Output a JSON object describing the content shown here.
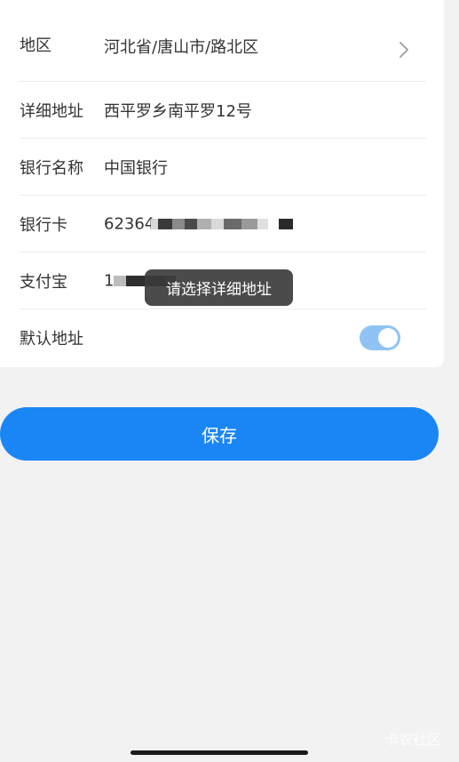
{
  "form": {
    "region": {
      "label": "地区",
      "value": "河北省/唐山市/路北区"
    },
    "address": {
      "label": "详细地址",
      "value": "西平罗乡南平罗12号"
    },
    "bank_name": {
      "label": "银行名称",
      "value": "中国银行"
    },
    "bank_card": {
      "label": "银行卡",
      "value": "62364"
    },
    "alipay": {
      "label": "支付宝",
      "value": "1"
    },
    "default_address": {
      "label": "默认地址",
      "enabled": true
    }
  },
  "toast": {
    "message": "请选择详细地址"
  },
  "actions": {
    "save_label": "保存"
  },
  "watermark": {
    "text": "卡农社区"
  },
  "colors": {
    "primary": "#1a86f5",
    "toggle_on": "#8fc3f5",
    "background": "#f2f2f2"
  },
  "icons": {
    "region_chevron": "chevron-right-icon"
  }
}
